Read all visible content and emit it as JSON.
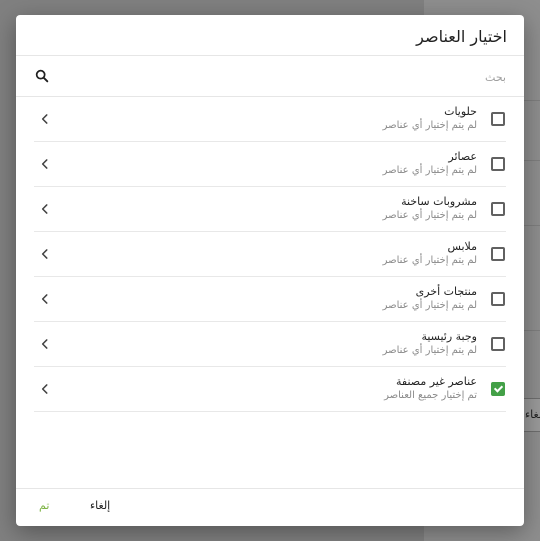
{
  "dialog": {
    "title": "اختيار العناصر",
    "search_placeholder": "بحث",
    "cancel_label": "إلغاء",
    "done_label": "تم"
  },
  "items": [
    {
      "name": "حلويات",
      "status": "لم يتم إختيار أي عناصر",
      "checked": false
    },
    {
      "name": "عصائر",
      "status": "لم يتم إختيار أي عناصر",
      "checked": false
    },
    {
      "name": "مشروبات ساخنة",
      "status": "لم يتم إختيار أي عناصر",
      "checked": false
    },
    {
      "name": "ملابس",
      "status": "لم يتم إختيار أي عناصر",
      "checked": false
    },
    {
      "name": "منتجات أخرى",
      "status": "لم يتم إختيار أي عناصر",
      "checked": false
    },
    {
      "name": "وجبة رئيسية",
      "status": "لم يتم إختيار أي عناصر",
      "checked": false
    },
    {
      "name": "عناصر غير مصنفة",
      "status": "تم إختيار جميع العناصر",
      "checked": true
    }
  ],
  "background": {
    "button_label": "إلغاء"
  },
  "colors": {
    "accent": "#43a047",
    "done_text": "#7cb342"
  },
  "icons": {
    "search": "search-icon",
    "row_chevron": "chevron-left-icon"
  }
}
